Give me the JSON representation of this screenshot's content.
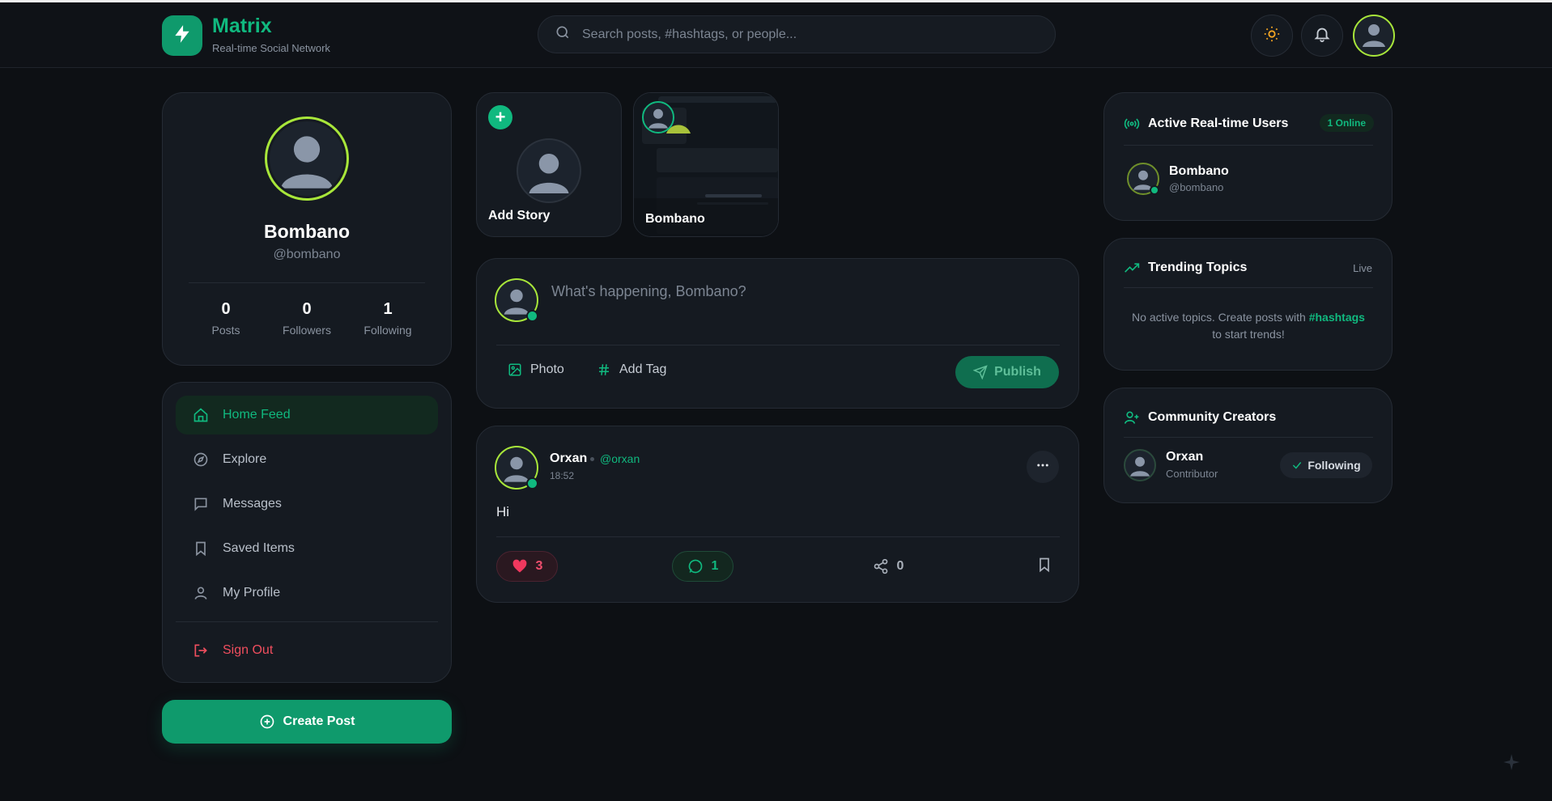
{
  "header": {
    "brand_title": "Matrix",
    "brand_subtitle": "Real-time Social Network",
    "search_placeholder": "Search posts, #hashtags, or people...",
    "icons": [
      "bolt-icon",
      "search-icon",
      "sun-icon",
      "bell-icon",
      "avatar"
    ]
  },
  "profile": {
    "name": "Bombano",
    "handle": "@bombano",
    "stats": [
      {
        "value": "0",
        "label": "Posts"
      },
      {
        "value": "0",
        "label": "Followers"
      },
      {
        "value": "1",
        "label": "Following"
      }
    ]
  },
  "nav": {
    "items": [
      {
        "label": "Home Feed",
        "icon": "home-icon",
        "active": true
      },
      {
        "label": "Explore",
        "icon": "compass-icon"
      },
      {
        "label": "Messages",
        "icon": "message-icon"
      },
      {
        "label": "Saved Items",
        "icon": "bookmark-icon"
      },
      {
        "label": "My Profile",
        "icon": "user-icon"
      }
    ],
    "signout_label": "Sign Out"
  },
  "create_post_label": "Create Post",
  "stories": [
    {
      "label": "Add Story"
    },
    {
      "label": "Bombano"
    }
  ],
  "composer": {
    "placeholder": "What's happening, Bombano?",
    "photo_label": "Photo",
    "tag_label": "Add Tag",
    "publish_label": "Publish"
  },
  "post": {
    "author": "Orxan",
    "handle": "@orxan",
    "time": "18:52",
    "body": "Hi",
    "likes": "3",
    "comments": "1",
    "shares": "0"
  },
  "active_users": {
    "title": "Active Real-time Users",
    "badge": "1 Online",
    "users": [
      {
        "name": "Bombano",
        "handle": "@bombano"
      }
    ]
  },
  "trending": {
    "title": "Trending Topics",
    "live_label": "Live",
    "empty_before": "No active topics. Create posts with ",
    "empty_highlight": "#hashtags",
    "empty_after": "to start trends!"
  },
  "creators": {
    "title": "Community Creators",
    "items": [
      {
        "name": "Orxan",
        "role": "Contributor",
        "button": "Following"
      }
    ]
  },
  "colors": {
    "accent": "#10b97f",
    "avatar_ring": "#a8e63a",
    "danger": "#f04e5e",
    "background": "#0d1014",
    "card": "#151a21"
  }
}
